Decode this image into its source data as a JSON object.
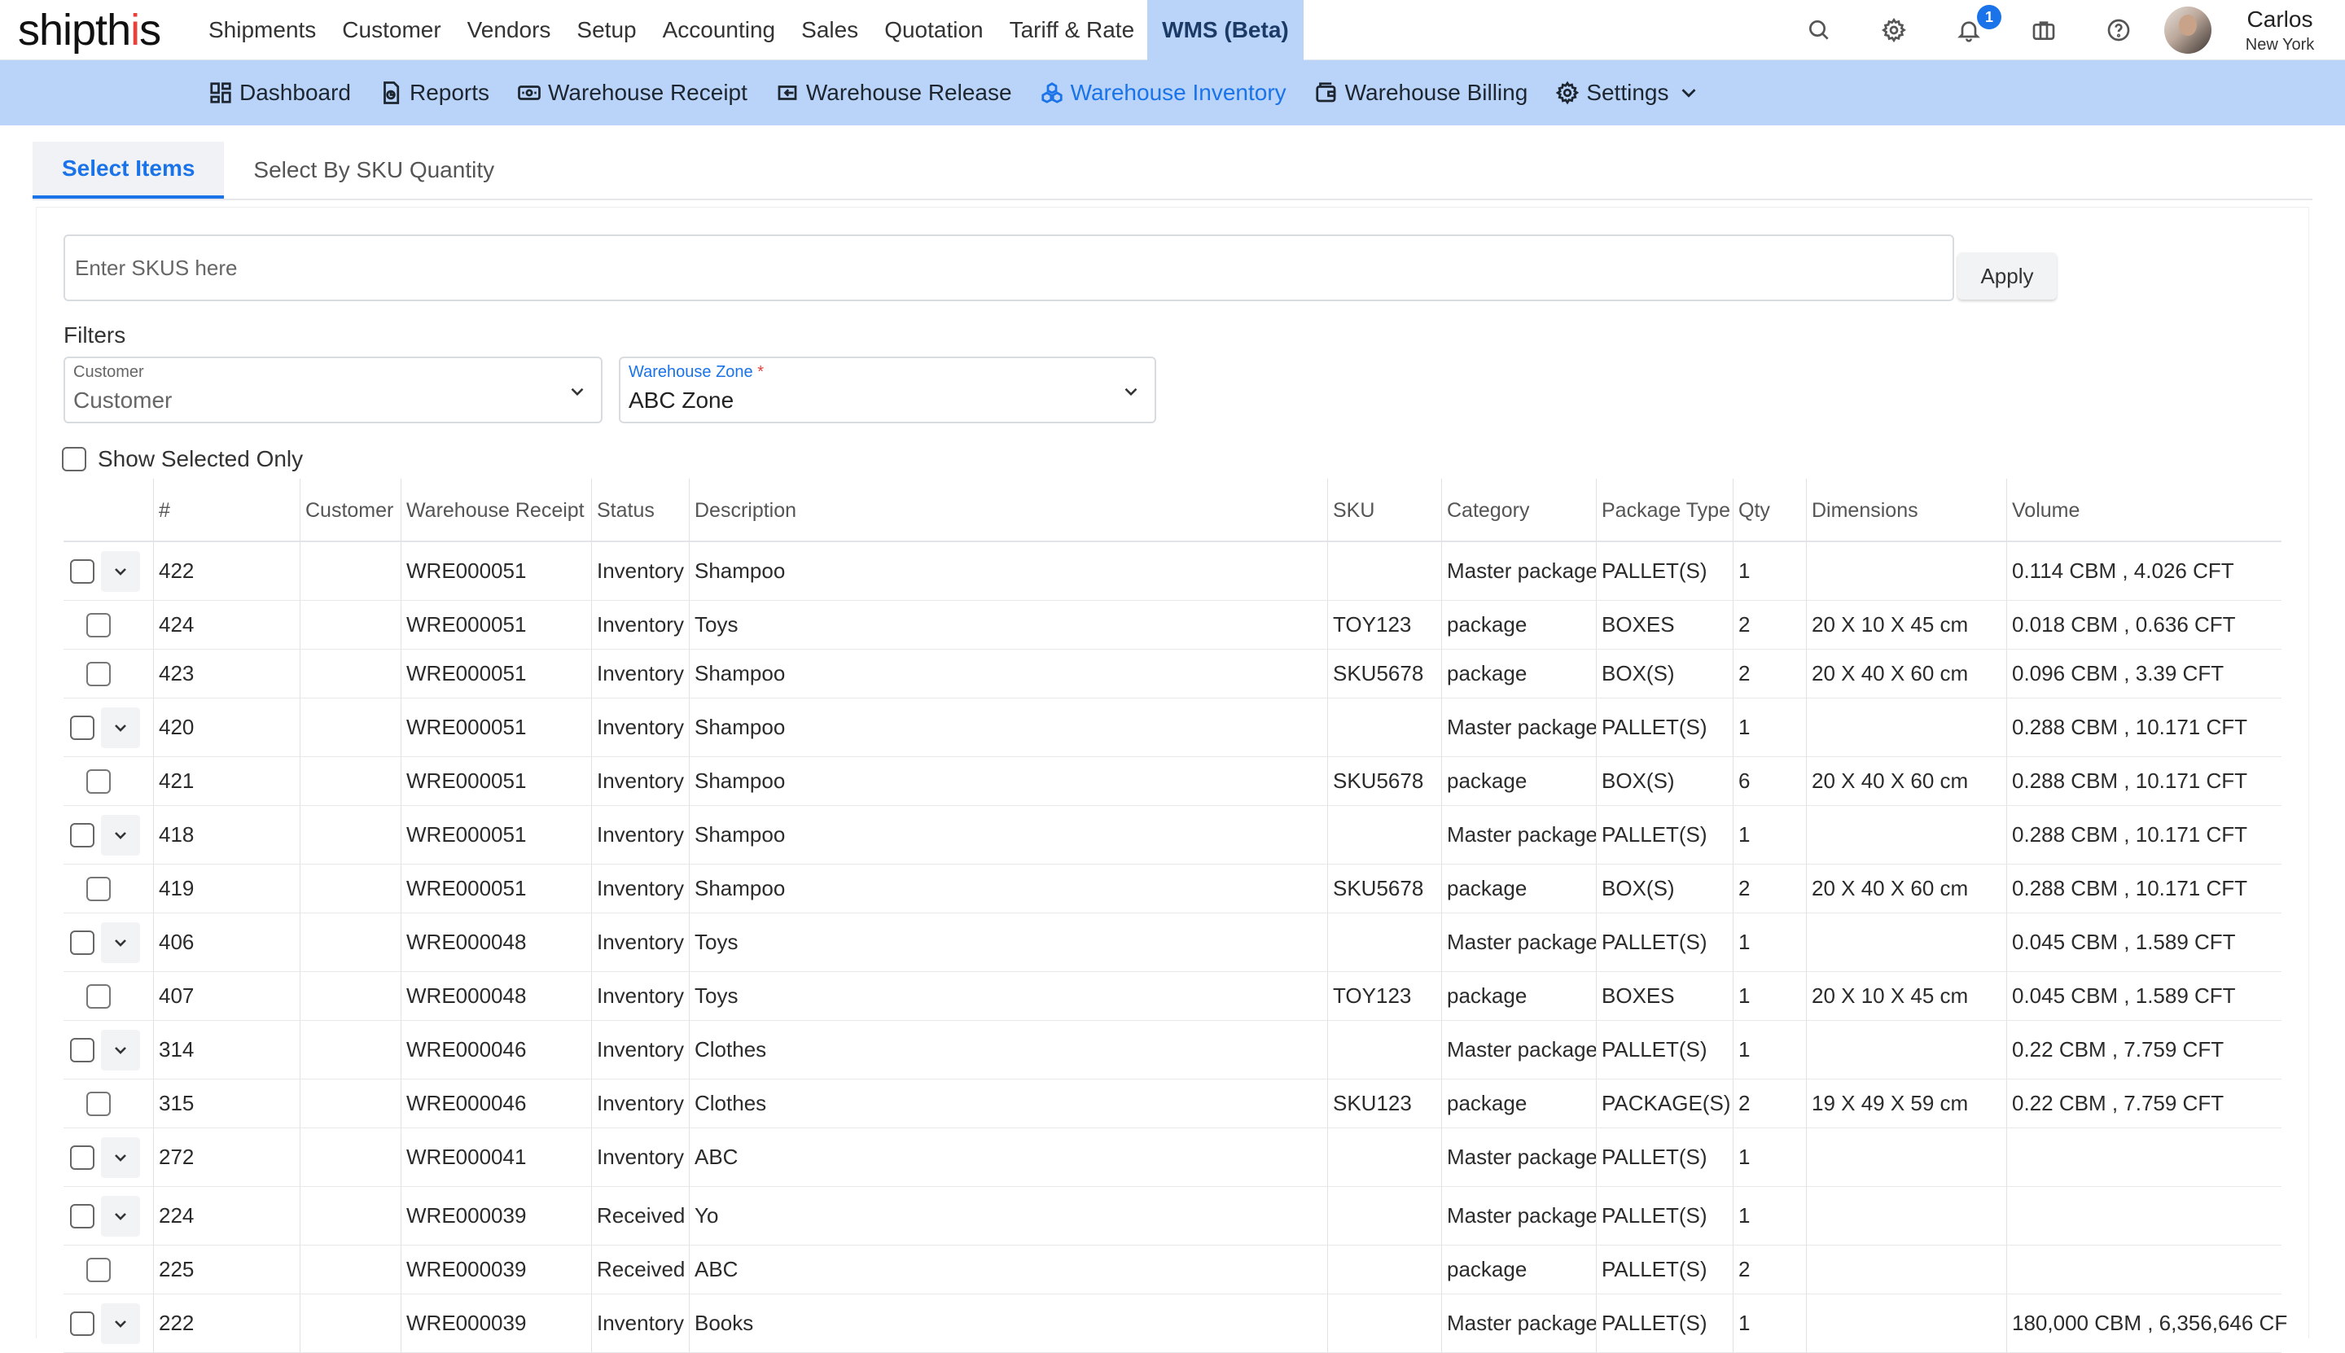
{
  "brand": {
    "logo_text": "shipthis"
  },
  "main_nav": [
    {
      "label": "Shipments",
      "active": false
    },
    {
      "label": "Customer",
      "active": false
    },
    {
      "label": "Vendors",
      "active": false
    },
    {
      "label": "Setup",
      "active": false
    },
    {
      "label": "Accounting",
      "active": false
    },
    {
      "label": "Sales",
      "active": false
    },
    {
      "label": "Quotation",
      "active": false
    },
    {
      "label": "Tariff & Rate",
      "active": false
    },
    {
      "label": "WMS (Beta)",
      "active": true
    }
  ],
  "header_icons": {
    "search": "search-icon",
    "settings": "gear-icon",
    "notifications": "bell-icon",
    "notification_count": "1",
    "apps": "briefcase-icon",
    "help": "help-icon"
  },
  "user": {
    "name": "Carlos",
    "location": "New York"
  },
  "sub_nav": [
    {
      "label": "Dashboard",
      "icon": "dashboard-icon",
      "active": false
    },
    {
      "label": "Reports",
      "icon": "report-icon",
      "active": false
    },
    {
      "label": "Warehouse Receipt",
      "icon": "receipt-icon",
      "active": false
    },
    {
      "label": "Warehouse Release",
      "icon": "release-icon",
      "active": false
    },
    {
      "label": "Warehouse Inventory",
      "icon": "inventory-icon",
      "active": true
    },
    {
      "label": "Warehouse Billing",
      "icon": "billing-icon",
      "active": false
    },
    {
      "label": "Settings",
      "icon": "gear-icon",
      "active": false,
      "dropdown": true
    }
  ],
  "tabs": [
    {
      "label": "Select Items",
      "active": true
    },
    {
      "label": "Select By SKU Quantity",
      "active": false
    }
  ],
  "sku_search": {
    "placeholder": "Enter SKUS here",
    "value": "",
    "apply_label": "Apply"
  },
  "filters": {
    "title": "Filters",
    "customer": {
      "label": "Customer",
      "value": "Customer"
    },
    "warehouse_zone": {
      "label": "Warehouse Zone",
      "required_mark": "*",
      "value": "ABC Zone"
    },
    "show_selected_only": {
      "label": "Show Selected Only",
      "checked": false
    }
  },
  "table": {
    "columns": [
      "#",
      "Customer",
      "Warehouse Receipt",
      "Status",
      "Description",
      "SKU",
      "Category",
      "Package Type",
      "Qty",
      "Dimensions",
      "Volume"
    ],
    "rows": [
      {
        "type": "master",
        "id": "422",
        "customer": "",
        "receipt": "WRE000051",
        "status": "Inventory",
        "description": "Shampoo",
        "sku": "",
        "category": "Master package",
        "package_type": "PALLET(S)",
        "qty": "1",
        "dimensions": "",
        "volume": "0.114 CBM , 4.026 CFT"
      },
      {
        "type": "child",
        "id": "424",
        "customer": "",
        "receipt": "WRE000051",
        "status": "Inventory",
        "description": "Toys",
        "sku": "TOY123",
        "category": "package",
        "package_type": "BOXES",
        "qty": "2",
        "dimensions": "20 X 10 X 45 cm",
        "volume": "0.018 CBM , 0.636 CFT"
      },
      {
        "type": "child",
        "id": "423",
        "customer": "",
        "receipt": "WRE000051",
        "status": "Inventory",
        "description": "Shampoo",
        "sku": "SKU5678",
        "category": "package",
        "package_type": "BOX(S)",
        "qty": "2",
        "dimensions": "20 X 40 X 60 cm",
        "volume": "0.096 CBM , 3.39 CFT"
      },
      {
        "type": "master",
        "id": "420",
        "customer": "",
        "receipt": "WRE000051",
        "status": "Inventory",
        "description": "Shampoo",
        "sku": "",
        "category": "Master package",
        "package_type": "PALLET(S)",
        "qty": "1",
        "dimensions": "",
        "volume": "0.288 CBM , 10.171 CFT"
      },
      {
        "type": "child",
        "id": "421",
        "customer": "",
        "receipt": "WRE000051",
        "status": "Inventory",
        "description": "Shampoo",
        "sku": "SKU5678",
        "category": "package",
        "package_type": "BOX(S)",
        "qty": "6",
        "dimensions": "20 X 40 X 60 cm",
        "volume": "0.288 CBM , 10.171 CFT"
      },
      {
        "type": "master",
        "id": "418",
        "customer": "",
        "receipt": "WRE000051",
        "status": "Inventory",
        "description": "Shampoo",
        "sku": "",
        "category": "Master package",
        "package_type": "PALLET(S)",
        "qty": "1",
        "dimensions": "",
        "volume": "0.288 CBM , 10.171 CFT"
      },
      {
        "type": "child",
        "id": "419",
        "customer": "",
        "receipt": "WRE000051",
        "status": "Inventory",
        "description": "Shampoo",
        "sku": "SKU5678",
        "category": "package",
        "package_type": "BOX(S)",
        "qty": "2",
        "dimensions": "20 X 40 X 60 cm",
        "volume": "0.288 CBM , 10.171 CFT"
      },
      {
        "type": "master",
        "id": "406",
        "customer": "",
        "receipt": "WRE000048",
        "status": "Inventory",
        "description": "Toys",
        "sku": "",
        "category": "Master package",
        "package_type": "PALLET(S)",
        "qty": "1",
        "dimensions": "",
        "volume": "0.045 CBM , 1.589 CFT"
      },
      {
        "type": "child",
        "id": "407",
        "customer": "",
        "receipt": "WRE000048",
        "status": "Inventory",
        "description": "Toys",
        "sku": "TOY123",
        "category": "package",
        "package_type": "BOXES",
        "qty": "1",
        "dimensions": "20 X 10 X 45 cm",
        "volume": "0.045 CBM , 1.589 CFT"
      },
      {
        "type": "master",
        "id": "314",
        "customer": "",
        "receipt": "WRE000046",
        "status": "Inventory",
        "description": "Clothes",
        "sku": "",
        "category": "Master package",
        "package_type": "PALLET(S)",
        "qty": "1",
        "dimensions": "",
        "volume": "0.22 CBM , 7.759 CFT"
      },
      {
        "type": "child",
        "id": "315",
        "customer": "",
        "receipt": "WRE000046",
        "status": "Inventory",
        "description": "Clothes",
        "sku": "SKU123",
        "category": "package",
        "package_type": "PACKAGE(S)",
        "qty": "2",
        "dimensions": "19 X 49 X 59 cm",
        "volume": "0.22 CBM , 7.759 CFT"
      },
      {
        "type": "master",
        "id": "272",
        "customer": "",
        "receipt": "WRE000041",
        "status": "Inventory",
        "description": "ABC",
        "sku": "",
        "category": "Master package",
        "package_type": "PALLET(S)",
        "qty": "1",
        "dimensions": "",
        "volume": ""
      },
      {
        "type": "master",
        "id": "224",
        "customer": "",
        "receipt": "WRE000039",
        "status": "Received",
        "description": "Yo",
        "sku": "",
        "category": "Master package",
        "package_type": "PALLET(S)",
        "qty": "1",
        "dimensions": "",
        "volume": ""
      },
      {
        "type": "child",
        "id": "225",
        "customer": "",
        "receipt": "WRE000039",
        "status": "Received",
        "description": "ABC",
        "sku": "",
        "category": "package",
        "package_type": "PALLET(S)",
        "qty": "2",
        "dimensions": "",
        "volume": ""
      },
      {
        "type": "master",
        "id": "222",
        "customer": "",
        "receipt": "WRE000039",
        "status": "Inventory",
        "description": "Books",
        "sku": "",
        "category": "Master package",
        "package_type": "PALLET(S)",
        "qty": "1",
        "dimensions": "",
        "volume": "180,000 CBM , 6,356,646 CF"
      }
    ]
  },
  "colors": {
    "accent": "#1a73e8",
    "subnav_bg": "#b9d4f8",
    "badge": "#1a73e8",
    "logo_dot": "#e8413c"
  }
}
